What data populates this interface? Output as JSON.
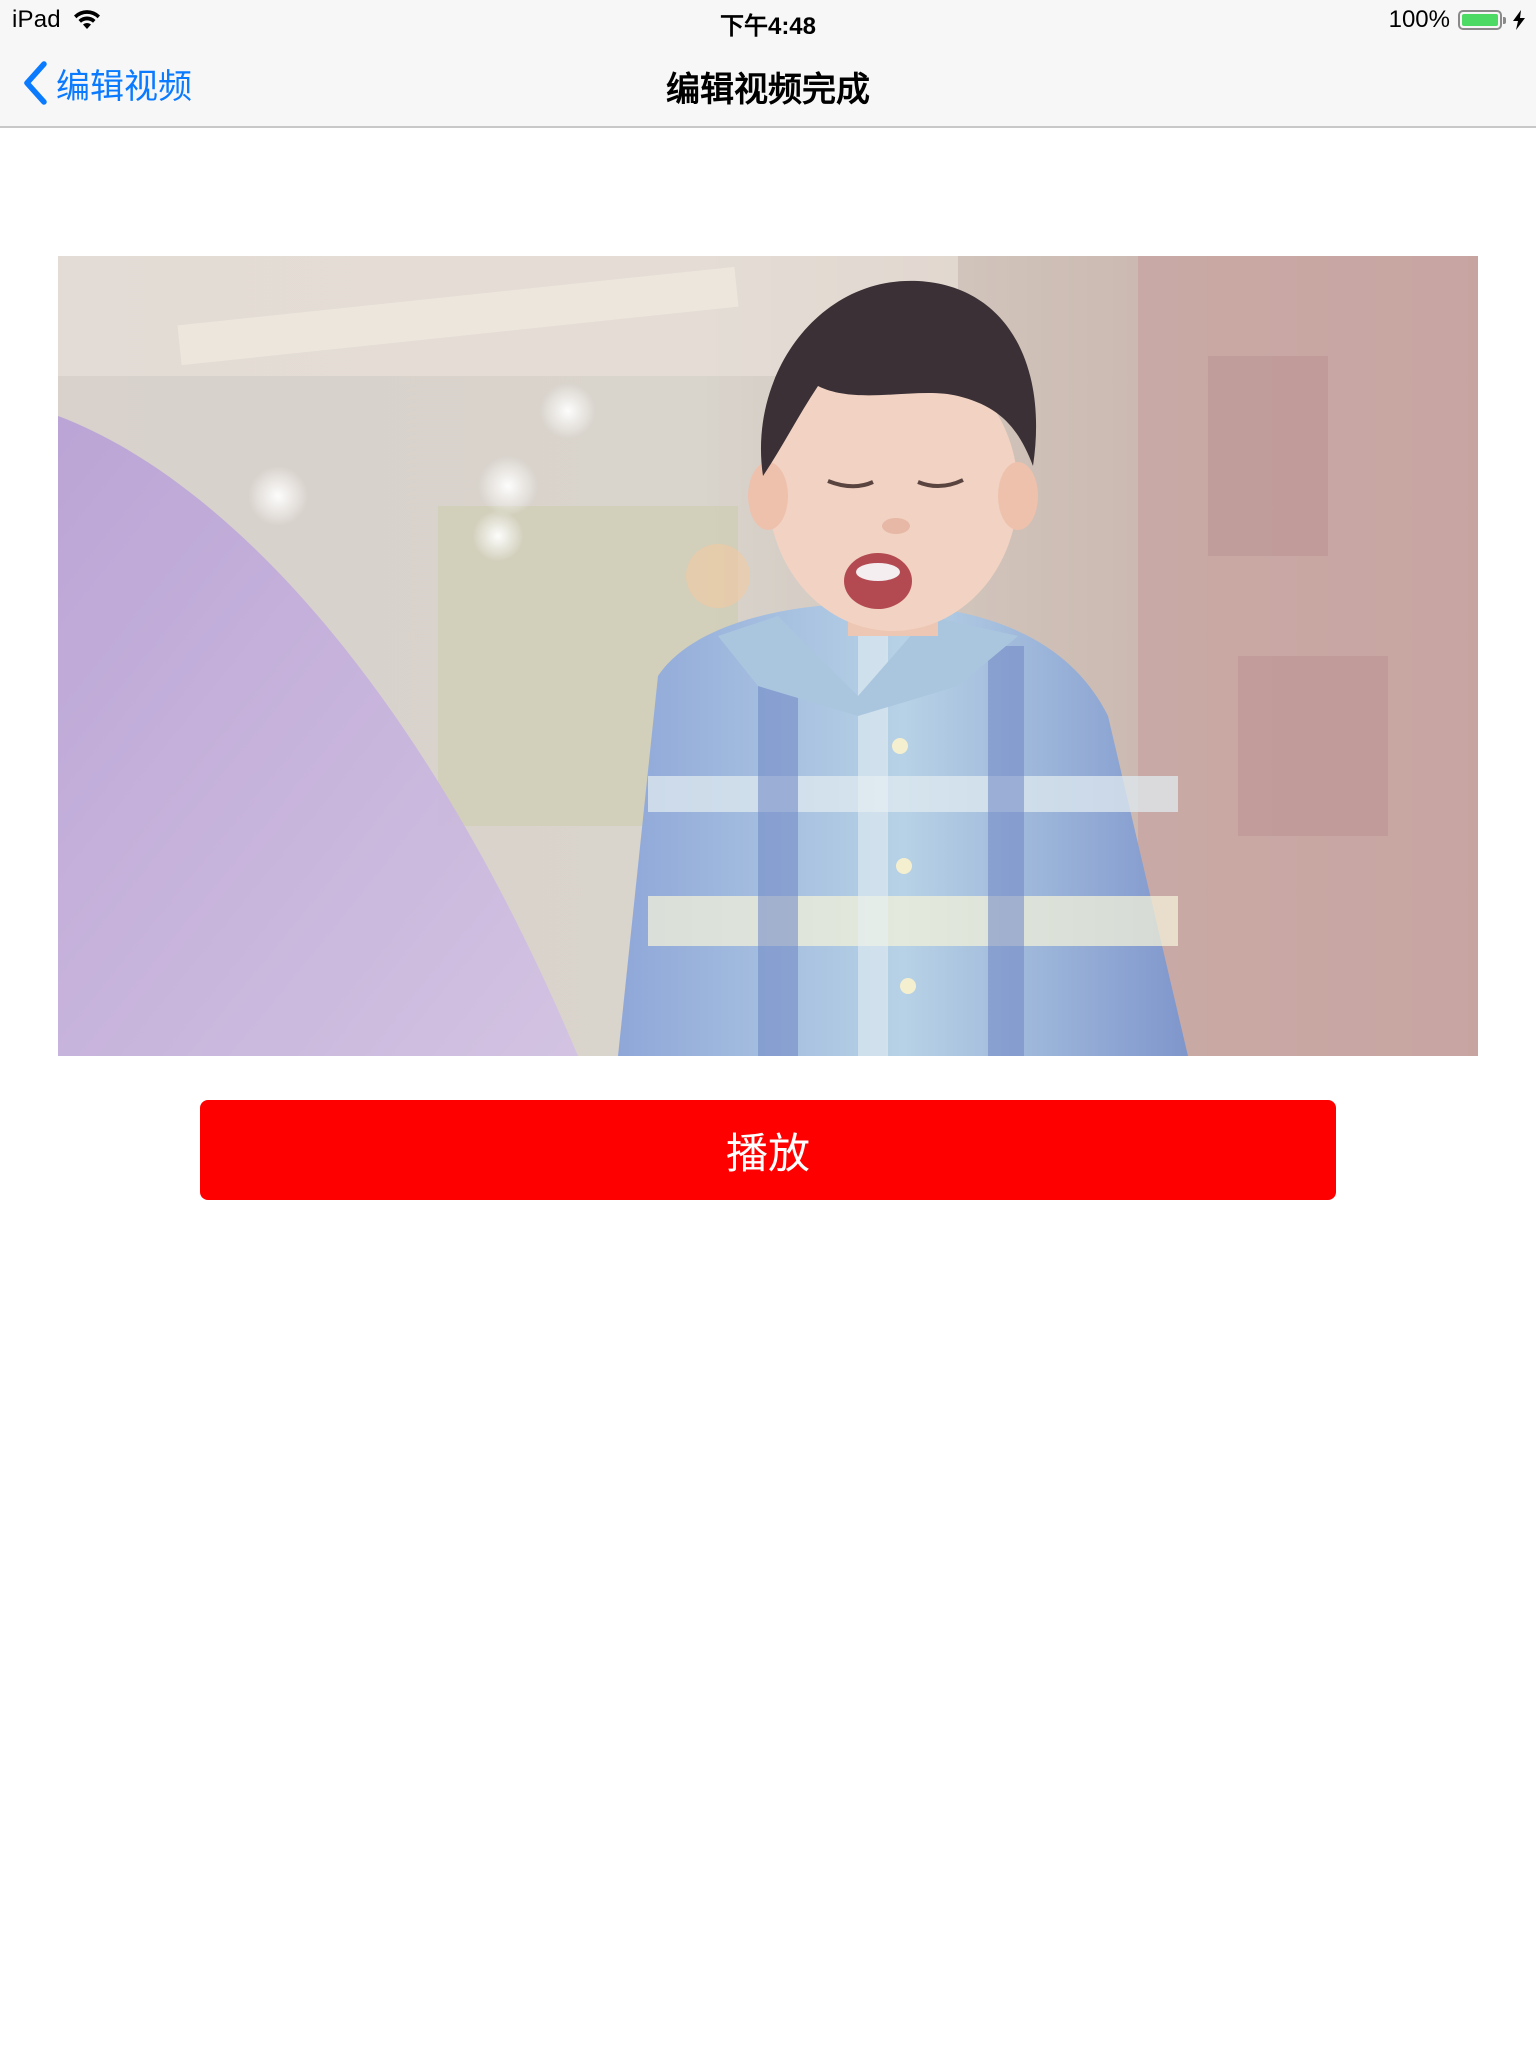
{
  "status_bar": {
    "device": "iPad",
    "time": "下午4:48",
    "battery_text": "100%",
    "battery_level": 1.0,
    "wifi_icon": "wifi-icon",
    "charging_icon": "charging-bolt-icon"
  },
  "nav": {
    "back_label": "编辑视频",
    "title": "编辑视频完成",
    "accent_color": "#0a7aff"
  },
  "video": {
    "content": "video-preview-frame"
  },
  "actions": {
    "play_label": "播放",
    "play_color": "#ff0000"
  }
}
